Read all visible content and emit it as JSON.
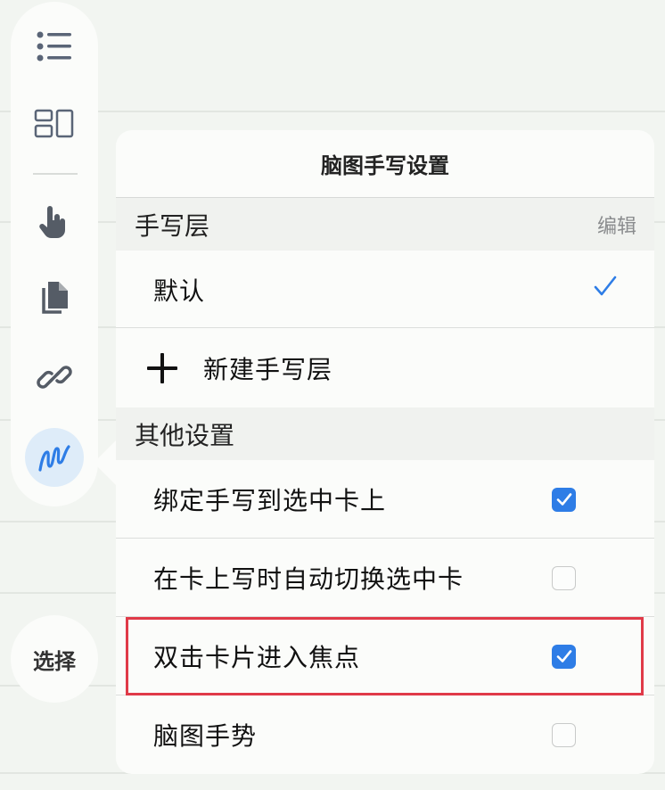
{
  "sidebar": {
    "tools": [
      {
        "icon": "list-icon"
      },
      {
        "icon": "layout-icon"
      },
      {
        "icon": "hand-pointer-icon"
      },
      {
        "icon": "copy-pages-icon"
      },
      {
        "icon": "link-icon"
      },
      {
        "icon": "handwriting-icon",
        "active": true
      }
    ],
    "select_label": "选择"
  },
  "panel": {
    "title": "脑图手写设置",
    "layers_section": {
      "title": "手写层",
      "action": "编辑"
    },
    "layers": [
      {
        "label": "默认",
        "selected": true
      }
    ],
    "new_layer_label": "新建手写层",
    "other_section": {
      "title": "其他设置"
    },
    "settings": [
      {
        "label": "绑定手写到选中卡上",
        "checked": true
      },
      {
        "label": "在卡上写时自动切换选中卡",
        "checked": false
      },
      {
        "label": "双击卡片进入焦点",
        "checked": true
      },
      {
        "label": "脑图手势",
        "checked": false
      }
    ]
  },
  "colors": {
    "accent": "#2e7de6",
    "highlight": "#e03a48",
    "active_tool_bg": "#deecf9"
  }
}
